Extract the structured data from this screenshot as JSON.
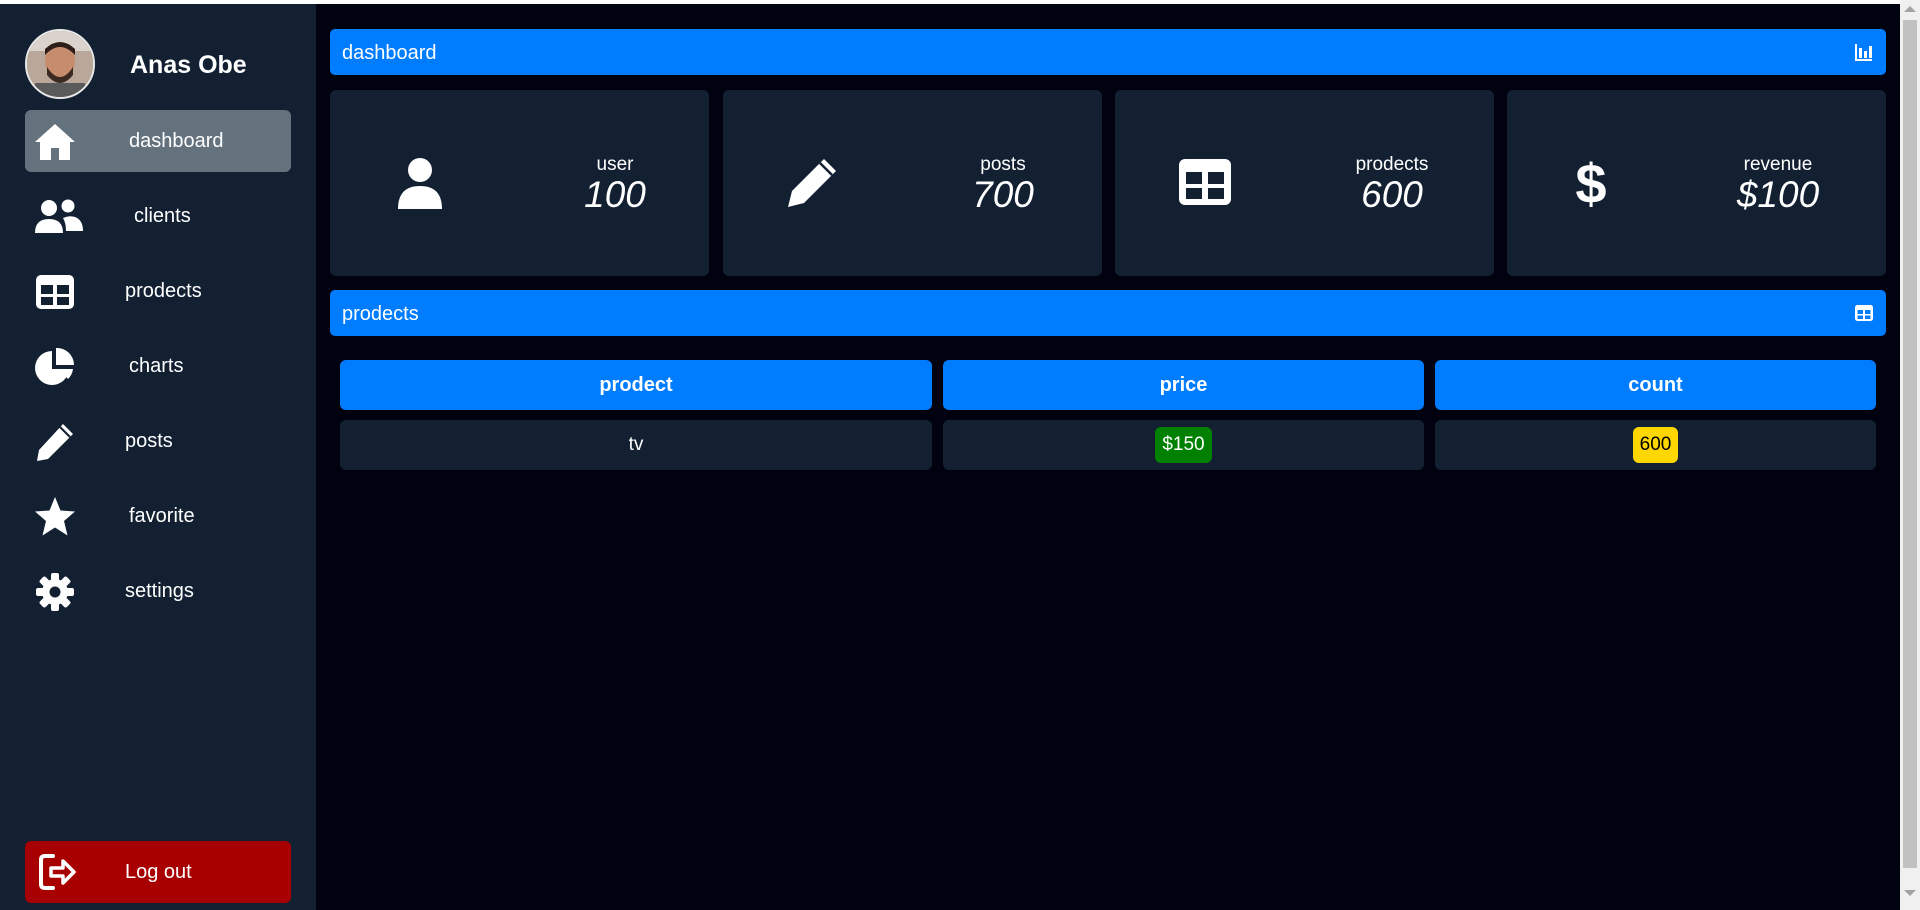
{
  "profile": {
    "name": "Anas Obe"
  },
  "sidebar": {
    "items": [
      {
        "label": "dashboard",
        "icon": "home-icon",
        "active": true
      },
      {
        "label": "clients",
        "icon": "users-icon"
      },
      {
        "label": "prodects",
        "icon": "table-icon"
      },
      {
        "label": "charts",
        "icon": "pie-chart-icon"
      },
      {
        "label": "posts",
        "icon": "pencil-icon"
      },
      {
        "label": "favorite",
        "icon": "star-icon"
      },
      {
        "label": "settings",
        "icon": "gear-icon"
      }
    ],
    "logout_label": "Log out"
  },
  "dashboard": {
    "title": "dashboard"
  },
  "stats": [
    {
      "label": "user",
      "value": "100",
      "icon": "user-icon"
    },
    {
      "label": "posts",
      "value": "700",
      "icon": "pencil-icon"
    },
    {
      "label": "prodects",
      "value": "600",
      "icon": "table-icon"
    },
    {
      "label": "revenue",
      "value": "$100",
      "icon": "dollar-icon"
    }
  ],
  "products": {
    "title": "prodects",
    "columns": [
      "prodect",
      "price",
      "count"
    ],
    "rows": [
      {
        "prodect": "tv",
        "price": "$150",
        "count": "600"
      }
    ]
  },
  "colors": {
    "accent": "#007cff",
    "sidebar": "#122032",
    "background": "#000210",
    "logout": "#a80000",
    "price_badge": "#008000",
    "count_badge": "#ffd700"
  }
}
